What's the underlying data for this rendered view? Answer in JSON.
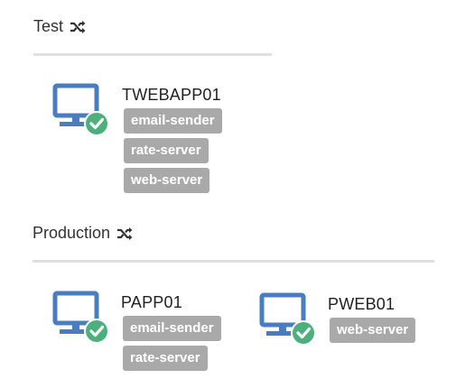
{
  "colors": {
    "monitor": "#4a7dbf",
    "check_badge": "#4caf7c",
    "tag_bg": "#a9a9a9",
    "divider": "#e0e0e0"
  },
  "environments": [
    {
      "name": "Test",
      "icon": "shuffle-icon",
      "machines": [
        {
          "host": "TWEBAPP01",
          "status_icon": "check-circle-icon",
          "tags": [
            "email-sender",
            "rate-server",
            "web-server"
          ]
        }
      ]
    },
    {
      "name": "Production",
      "icon": "shuffle-icon",
      "machines": [
        {
          "host": "PAPP01",
          "status_icon": "check-circle-icon",
          "tags": [
            "email-sender",
            "rate-server"
          ]
        },
        {
          "host": "PWEB01",
          "status_icon": "check-circle-icon",
          "tags": [
            "web-server"
          ]
        }
      ]
    }
  ]
}
